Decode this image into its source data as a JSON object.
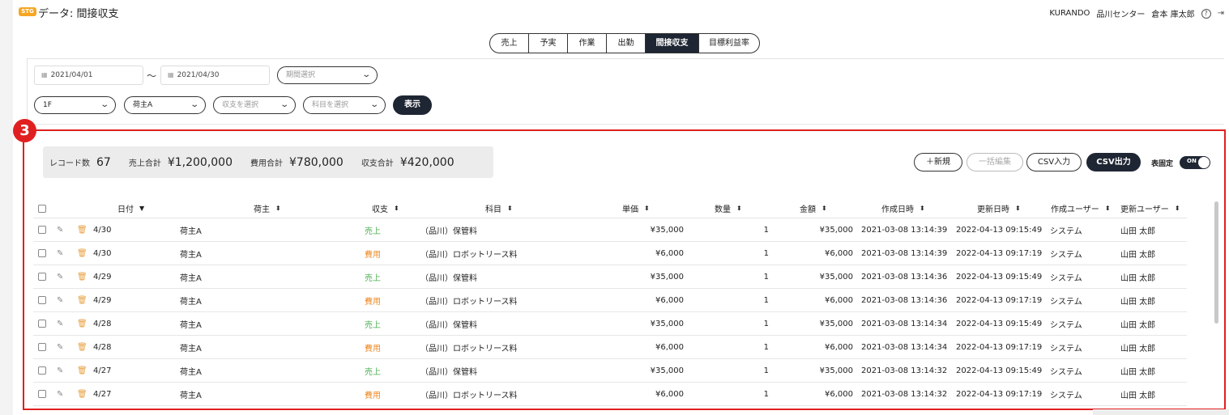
{
  "header": {
    "badge": "STG",
    "title": "データ: 間接収支",
    "company": "KURANDO",
    "center": "品川センター",
    "user": "倉本 庫太郎",
    "help_icon": "?",
    "logout_icon": "⇥"
  },
  "tabs": [
    {
      "label": "売上",
      "active": false
    },
    {
      "label": "予実",
      "active": false
    },
    {
      "label": "作業",
      "active": false
    },
    {
      "label": "出勤",
      "active": false
    },
    {
      "label": "間接収支",
      "active": true
    },
    {
      "label": "目標利益率",
      "active": false
    }
  ],
  "filters": {
    "date_from": "2021/04/01",
    "tilde": "〜",
    "date_to": "2021/04/30",
    "period_placeholder": "期間選択",
    "floor": "1F",
    "shipper": "荷主A",
    "income_placeholder": "収支を選択",
    "account_placeholder": "科目を選択",
    "show_label": "表示"
  },
  "callout_number": "3",
  "summary": {
    "records_label": "レコード数",
    "records_value": "67",
    "sales_label": "売上合計",
    "sales_value": "¥1,200,000",
    "cost_label": "費用合計",
    "cost_value": "¥780,000",
    "balance_label": "収支合計",
    "balance_value": "¥420,000"
  },
  "actions": {
    "new_label": "＋新規",
    "bulk_edit_label": "一括編集",
    "csv_import_label": "CSV入力",
    "csv_export_label": "CSV出力",
    "fixed_header_label": "表固定",
    "toggle_label": "ON"
  },
  "colors": {
    "dark": "#1f2633",
    "sales": "#4caf50",
    "cost": "#f08a24",
    "highlight": "#e02020",
    "stg_badge": "#f5a623"
  },
  "table": {
    "columns": {
      "date": "日付",
      "shipper": "荷主",
      "type": "収支",
      "account": "科目",
      "unit_price": "単価",
      "qty": "数量",
      "amount": "金額",
      "created_at": "作成日時",
      "updated_at": "更新日時",
      "created_by": "作成ユーザー",
      "updated_by": "更新ユーザー"
    },
    "rows": [
      {
        "date": "4/30",
        "shipper": "荷主A",
        "type": "売上",
        "kind": "sales",
        "account": "（品川）保管料",
        "unit_price": "¥35,000",
        "qty": "1",
        "amount": "¥35,000",
        "created_at": "2021-03-08 13:14:39",
        "updated_at": "2022-04-13 09:15:49",
        "created_by": "システム",
        "updated_by": "山田 太郎"
      },
      {
        "date": "4/30",
        "shipper": "荷主A",
        "type": "費用",
        "kind": "cost",
        "account": "（品川）ロボットリース料",
        "unit_price": "¥6,000",
        "qty": "1",
        "amount": "¥6,000",
        "created_at": "2021-03-08 13:14:39",
        "updated_at": "2022-04-13 09:17:19",
        "created_by": "システム",
        "updated_by": "山田 太郎"
      },
      {
        "date": "4/29",
        "shipper": "荷主A",
        "type": "売上",
        "kind": "sales",
        "account": "（品川）保管料",
        "unit_price": "¥35,000",
        "qty": "1",
        "amount": "¥35,000",
        "created_at": "2021-03-08 13:14:36",
        "updated_at": "2022-04-13 09:15:49",
        "created_by": "システム",
        "updated_by": "山田 太郎"
      },
      {
        "date": "4/29",
        "shipper": "荷主A",
        "type": "費用",
        "kind": "cost",
        "account": "（品川）ロボットリース料",
        "unit_price": "¥6,000",
        "qty": "1",
        "amount": "¥6,000",
        "created_at": "2021-03-08 13:14:36",
        "updated_at": "2022-04-13 09:17:19",
        "created_by": "システム",
        "updated_by": "山田 太郎"
      },
      {
        "date": "4/28",
        "shipper": "荷主A",
        "type": "売上",
        "kind": "sales",
        "account": "（品川）保管料",
        "unit_price": "¥35,000",
        "qty": "1",
        "amount": "¥35,000",
        "created_at": "2021-03-08 13:14:34",
        "updated_at": "2022-04-13 09:15:49",
        "created_by": "システム",
        "updated_by": "山田 太郎"
      },
      {
        "date": "4/28",
        "shipper": "荷主A",
        "type": "費用",
        "kind": "cost",
        "account": "（品川）ロボットリース料",
        "unit_price": "¥6,000",
        "qty": "1",
        "amount": "¥6,000",
        "created_at": "2021-03-08 13:14:34",
        "updated_at": "2022-04-13 09:17:19",
        "created_by": "システム",
        "updated_by": "山田 太郎"
      },
      {
        "date": "4/27",
        "shipper": "荷主A",
        "type": "売上",
        "kind": "sales",
        "account": "（品川）保管料",
        "unit_price": "¥35,000",
        "qty": "1",
        "amount": "¥35,000",
        "created_at": "2021-03-08 13:14:32",
        "updated_at": "2022-04-13 09:15:49",
        "created_by": "システム",
        "updated_by": "山田 太郎"
      },
      {
        "date": "4/27",
        "shipper": "荷主A",
        "type": "費用",
        "kind": "cost",
        "account": "（品川）ロボットリース料",
        "unit_price": "¥6,000",
        "qty": "1",
        "amount": "¥6,000",
        "created_at": "2021-03-08 13:14:32",
        "updated_at": "2022-04-13 09:17:19",
        "created_by": "システム",
        "updated_by": "山田 太郎"
      }
    ]
  }
}
